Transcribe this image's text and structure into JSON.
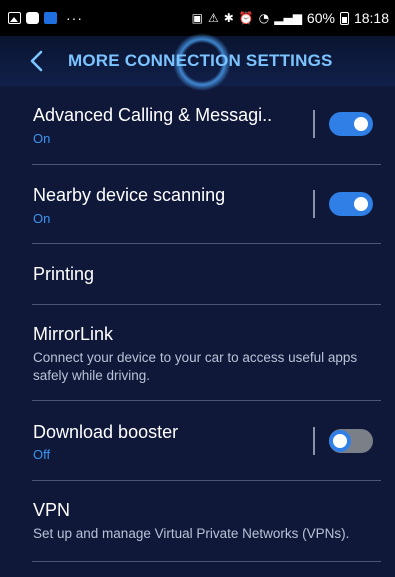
{
  "status_bar": {
    "icons_left": [
      "gallery-icon",
      "chat-icon",
      "app-icon"
    ],
    "more": "···",
    "icons_right": [
      "sim-icon",
      "alert-icon",
      "bluetooth-icon",
      "alarm-icon",
      "wifi-icon",
      "signal-icon"
    ],
    "battery": "60%",
    "time": "18:18"
  },
  "header": {
    "back_icon": "back-arrow-icon",
    "title": "MORE CONNECTION SETTINGS",
    "title_color": "#7cc4ff"
  },
  "settings": [
    {
      "title": "Advanced Calling & Messagi..",
      "status": "On",
      "toggle": true
    },
    {
      "title": "Nearby device scanning",
      "status": "On",
      "toggle": true
    },
    {
      "title": "Printing"
    },
    {
      "title": "MirrorLink",
      "description": "Connect your device to your car to access useful apps safely while driving."
    },
    {
      "title": "Download booster",
      "status": "Off",
      "toggle": false
    },
    {
      "title": "VPN",
      "description": "Set up and manage Virtual Private Networks (VPNs)."
    }
  ],
  "colors": {
    "background": "#10183a",
    "accent": "#2f7fe6",
    "status_text": "#3a95ef",
    "toggle_off": "#7b7f88"
  }
}
